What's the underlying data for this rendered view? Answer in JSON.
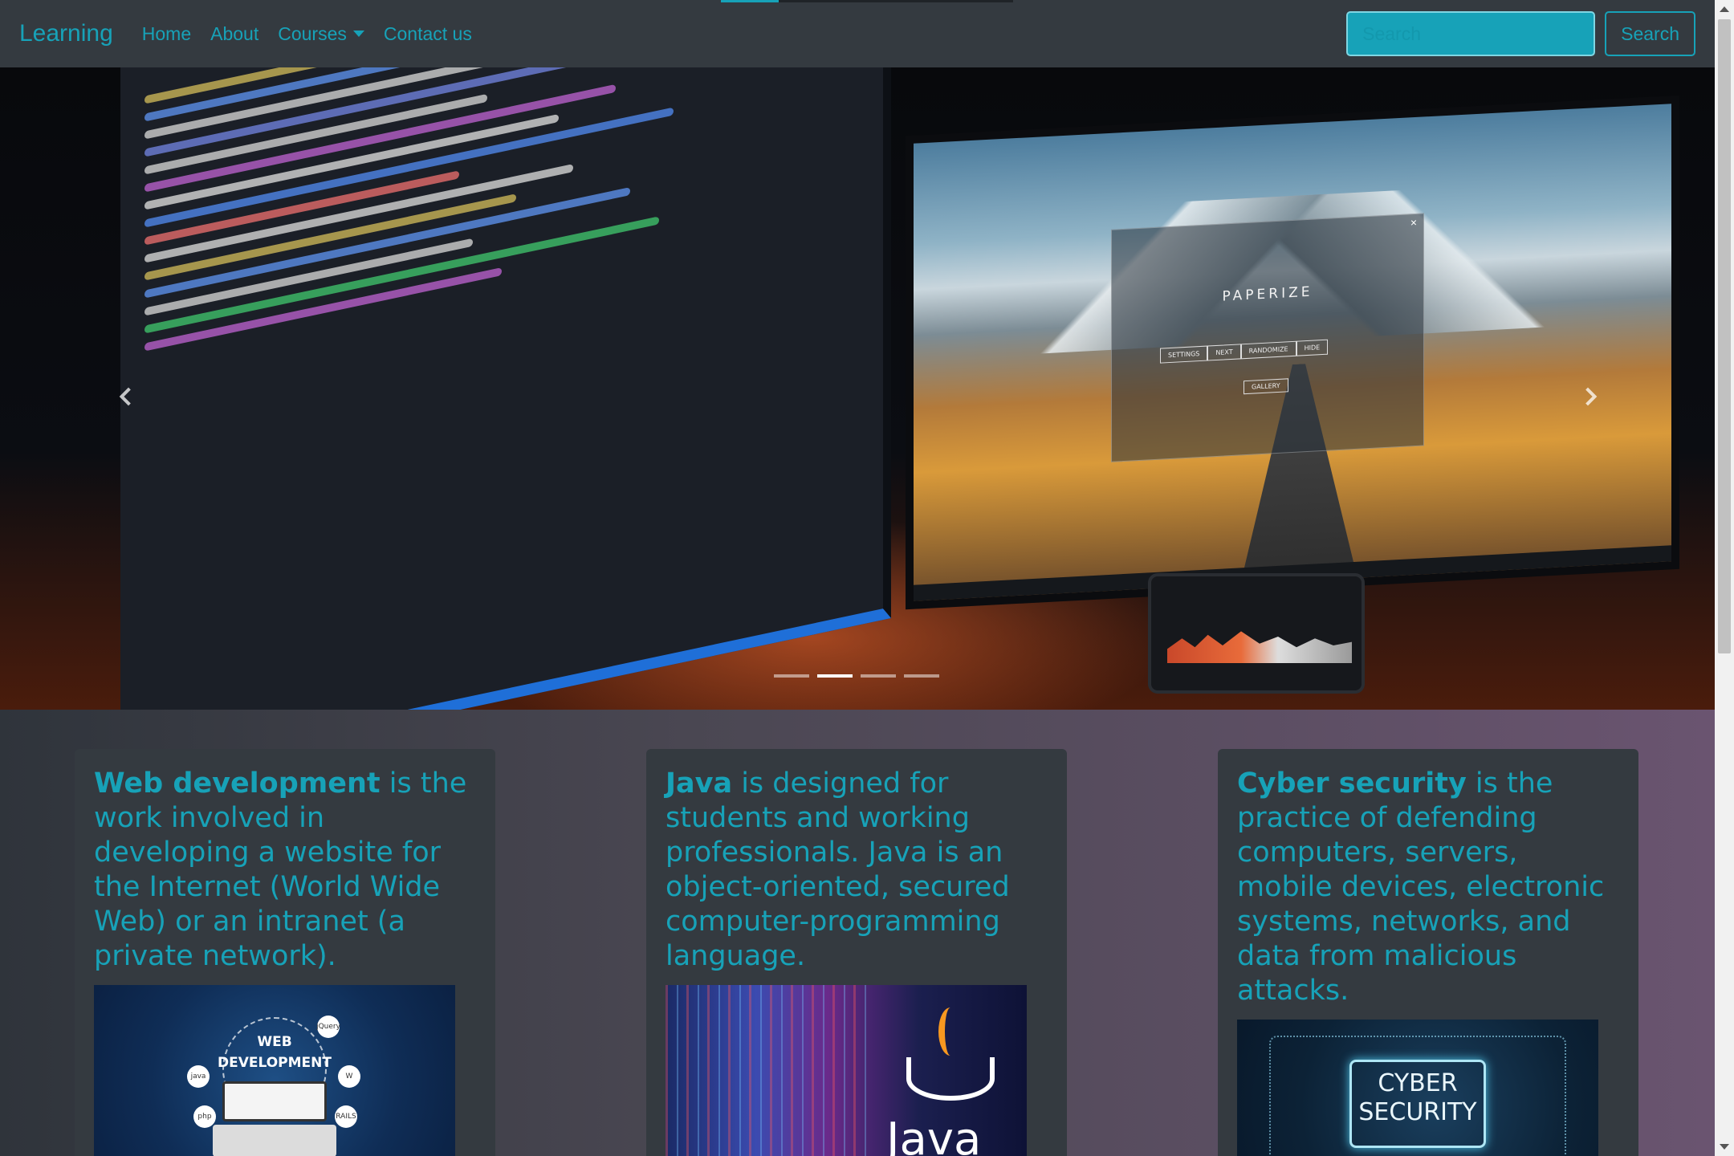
{
  "navbar": {
    "brand": "Learning",
    "links": [
      "Home",
      "About",
      "Courses",
      "Contact us"
    ],
    "search_placeholder": "Search",
    "search_button": "Search"
  },
  "carousel": {
    "slide_count": 4,
    "active_slide_index": 1,
    "screen_app_title": "PAPERIZE",
    "screen_app_buttons": [
      "SETTINGS",
      "NEXT",
      "RANDOMIZE",
      "HIDE"
    ],
    "screen_app_gallery": "GALLERY"
  },
  "cards": [
    {
      "title": "Web development",
      "body": " is the work involved in developing a website for the Internet (World Wide Web) or an intranet (a private network).",
      "image_text_line1": "WEB",
      "image_text_line2": "DEVELOPMENT",
      "image_badges": [
        "php",
        "java",
        "jQuery",
        "W",
        "RAILS"
      ]
    },
    {
      "title": "Java",
      "body": " is designed for students and working professionals. Java is an object-oriented, secured computer-programming language.",
      "image_text": "Java"
    },
    {
      "title": "Cyber security",
      "body": " is the practice of defending computers, servers, mobile devices, electronic systems, networks, and data from malicious attacks.",
      "image_text_line1": "CYBER",
      "image_text_line2": "SECURITY",
      "image_password": "******"
    }
  ],
  "colors": {
    "accent": "#17a2b8",
    "navbar_bg": "#343a40",
    "card_bg": "#343a40"
  }
}
